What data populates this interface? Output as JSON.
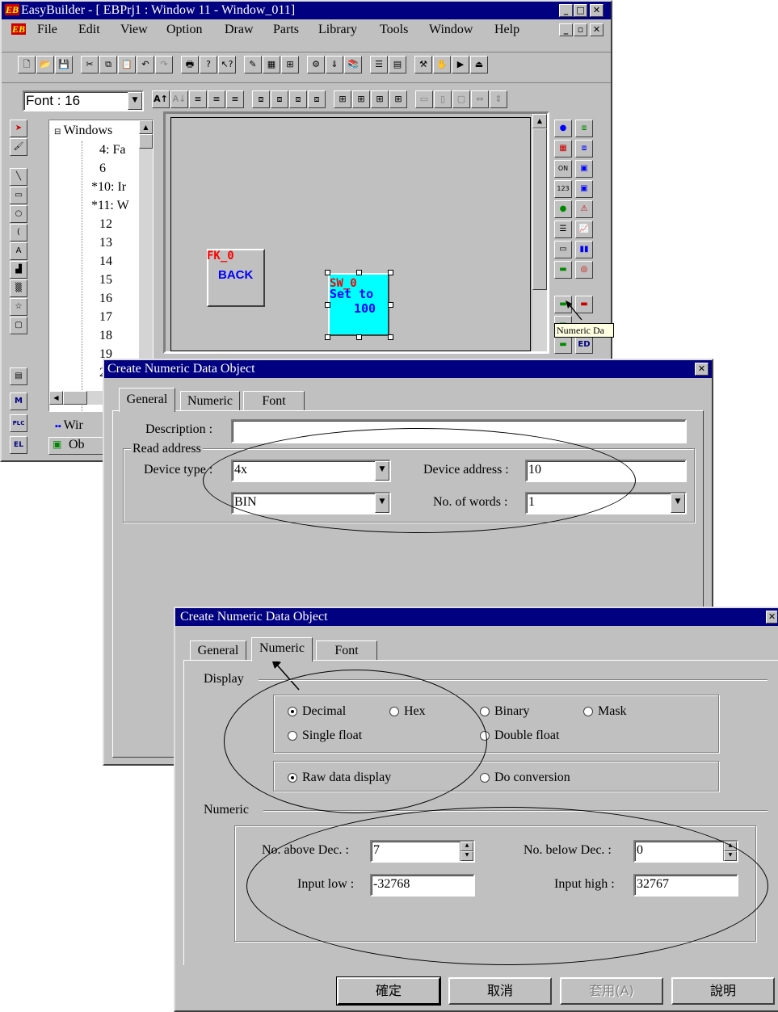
{
  "main_window": {
    "title": "EasyBuilder - [  EBPrj1  :  Window  11  -  Window_011]",
    "menu": [
      {
        "label": "File",
        "u": "F"
      },
      {
        "label": "Edit",
        "u": "E"
      },
      {
        "label": "View",
        "u": "V"
      },
      {
        "label": "Option",
        "u": "O"
      },
      {
        "label": "Draw",
        "u": "D"
      },
      {
        "label": "Parts",
        "u": "P"
      },
      {
        "label": "Library",
        "u": "L"
      },
      {
        "label": "Tools",
        "u": "T"
      },
      {
        "label": "Window",
        "u": "W"
      },
      {
        "label": "Help",
        "u": "H"
      }
    ],
    "font_select": "Font : 16",
    "tree": {
      "root": "Windows",
      "items": [
        "4: Fa",
        "6",
        "*10: Ir",
        "*11: W",
        "12",
        "13",
        "14",
        "15",
        "16",
        "17",
        "18",
        "19",
        "2"
      ]
    },
    "tree_tabs": {
      "tab1": "Wir",
      "tab2": "Ob"
    },
    "canvas": {
      "fk_tag": "FK_0",
      "fk_label": "BACK",
      "sw_tag": "SW_0",
      "sw_label_1": "Set to",
      "sw_label_2": "100"
    },
    "palette_ed": "ED",
    "tooltip": "Numeric Da"
  },
  "dialog_general": {
    "title": "Create Numeric Data Object",
    "tabs": [
      "General",
      "Numeric",
      "Font"
    ],
    "description_label": "Description :",
    "description_value": "",
    "group_label": "Read address",
    "device_type_label": "Device type :",
    "device_type_value": "4x",
    "format_value": "BIN",
    "device_address_label": "Device address :",
    "device_address_value": "10",
    "no_of_words_label": "No. of words :",
    "no_of_words_value": "1"
  },
  "dialog_numeric": {
    "title": "Create Numeric Data Object",
    "tabs": [
      "General",
      "Numeric",
      "Font"
    ],
    "display_group": "Display",
    "radios_format": [
      "Decimal",
      "Hex",
      "Binary",
      "Mask",
      "Single float",
      "Double float"
    ],
    "radios_conv": [
      "Raw data display",
      "Do conversion"
    ],
    "numeric_group": "Numeric",
    "above_label": "No. above Dec. :",
    "above_value": "7",
    "below_label": "No. below Dec. :",
    "below_value": "0",
    "low_label": "Input low :",
    "low_value": "-32768",
    "high_label": "Input high :",
    "high_value": "32767",
    "buttons": [
      "確定",
      "取消",
      "套用(A)",
      "說明"
    ]
  },
  "colors": {
    "titlebar": "#000080",
    "face": "#c0c0c0",
    "canvas": "#c0c0c0",
    "sw_fill": "#00ffff",
    "tag_red": "#ff0000",
    "label_blue": "#0000ff"
  }
}
